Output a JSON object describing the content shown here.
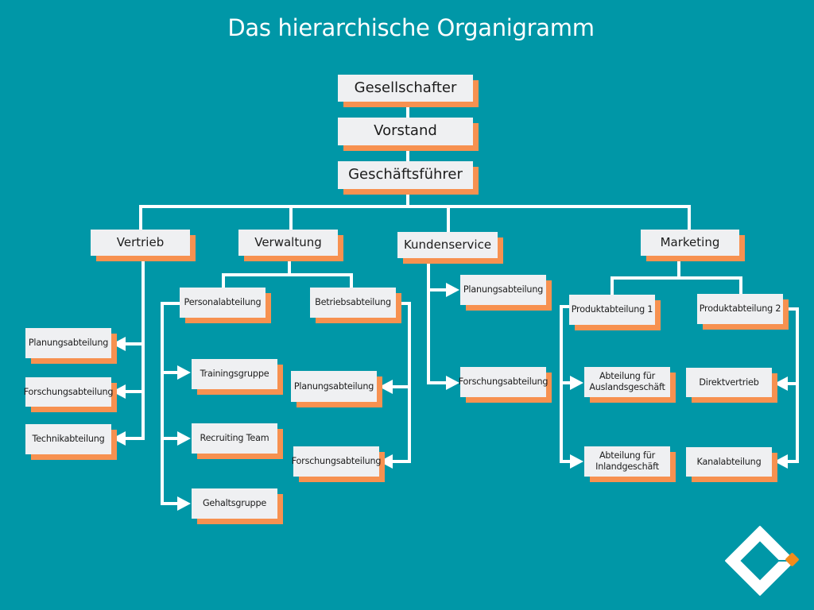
{
  "title": "Das hierarchische Organigramm",
  "colors": {
    "background": "#0097a7",
    "box": "#eff0f2",
    "box_shadow": "#f79150",
    "connector": "#ffffff",
    "logo_accent": "#f28c1a"
  },
  "top": {
    "gesellschafter": "Gesellschafter",
    "vorstand": "Vorstand",
    "geschaeftsfuehrer": "Geschäftsführer"
  },
  "departments": {
    "vertrieb": {
      "label": "Vertrieb",
      "children": [
        "Planungsabteilung",
        "Forschungsabteilung",
        "Technikabteilung"
      ]
    },
    "verwaltung": {
      "label": "Verwaltung",
      "personal": {
        "label": "Personalabteilung",
        "children": [
          "Trainingsgruppe",
          "Recruiting Team",
          "Gehaltsgruppe"
        ]
      },
      "betrieb": {
        "label": "Betriebsabteilung",
        "children": [
          "Planungsabteilung",
          "Forschungsabteilung"
        ]
      }
    },
    "kundenservice": {
      "label": "Kundenservice",
      "children": [
        "Planungsabteilung",
        "Forschungsabteilung"
      ]
    },
    "marketing": {
      "label": "Marketing",
      "produkt1": {
        "label": "Produktabteilung 1",
        "children": [
          "Abteilung für Auslandsgeschäft",
          "Abteilung für Inlandgeschäft"
        ]
      },
      "produkt2": {
        "label": "Produktabteilung 2",
        "children": [
          "Direktvertrieb",
          "Kanalabteilung"
        ]
      }
    }
  },
  "logo": {
    "icon": "company-logo-icon"
  }
}
